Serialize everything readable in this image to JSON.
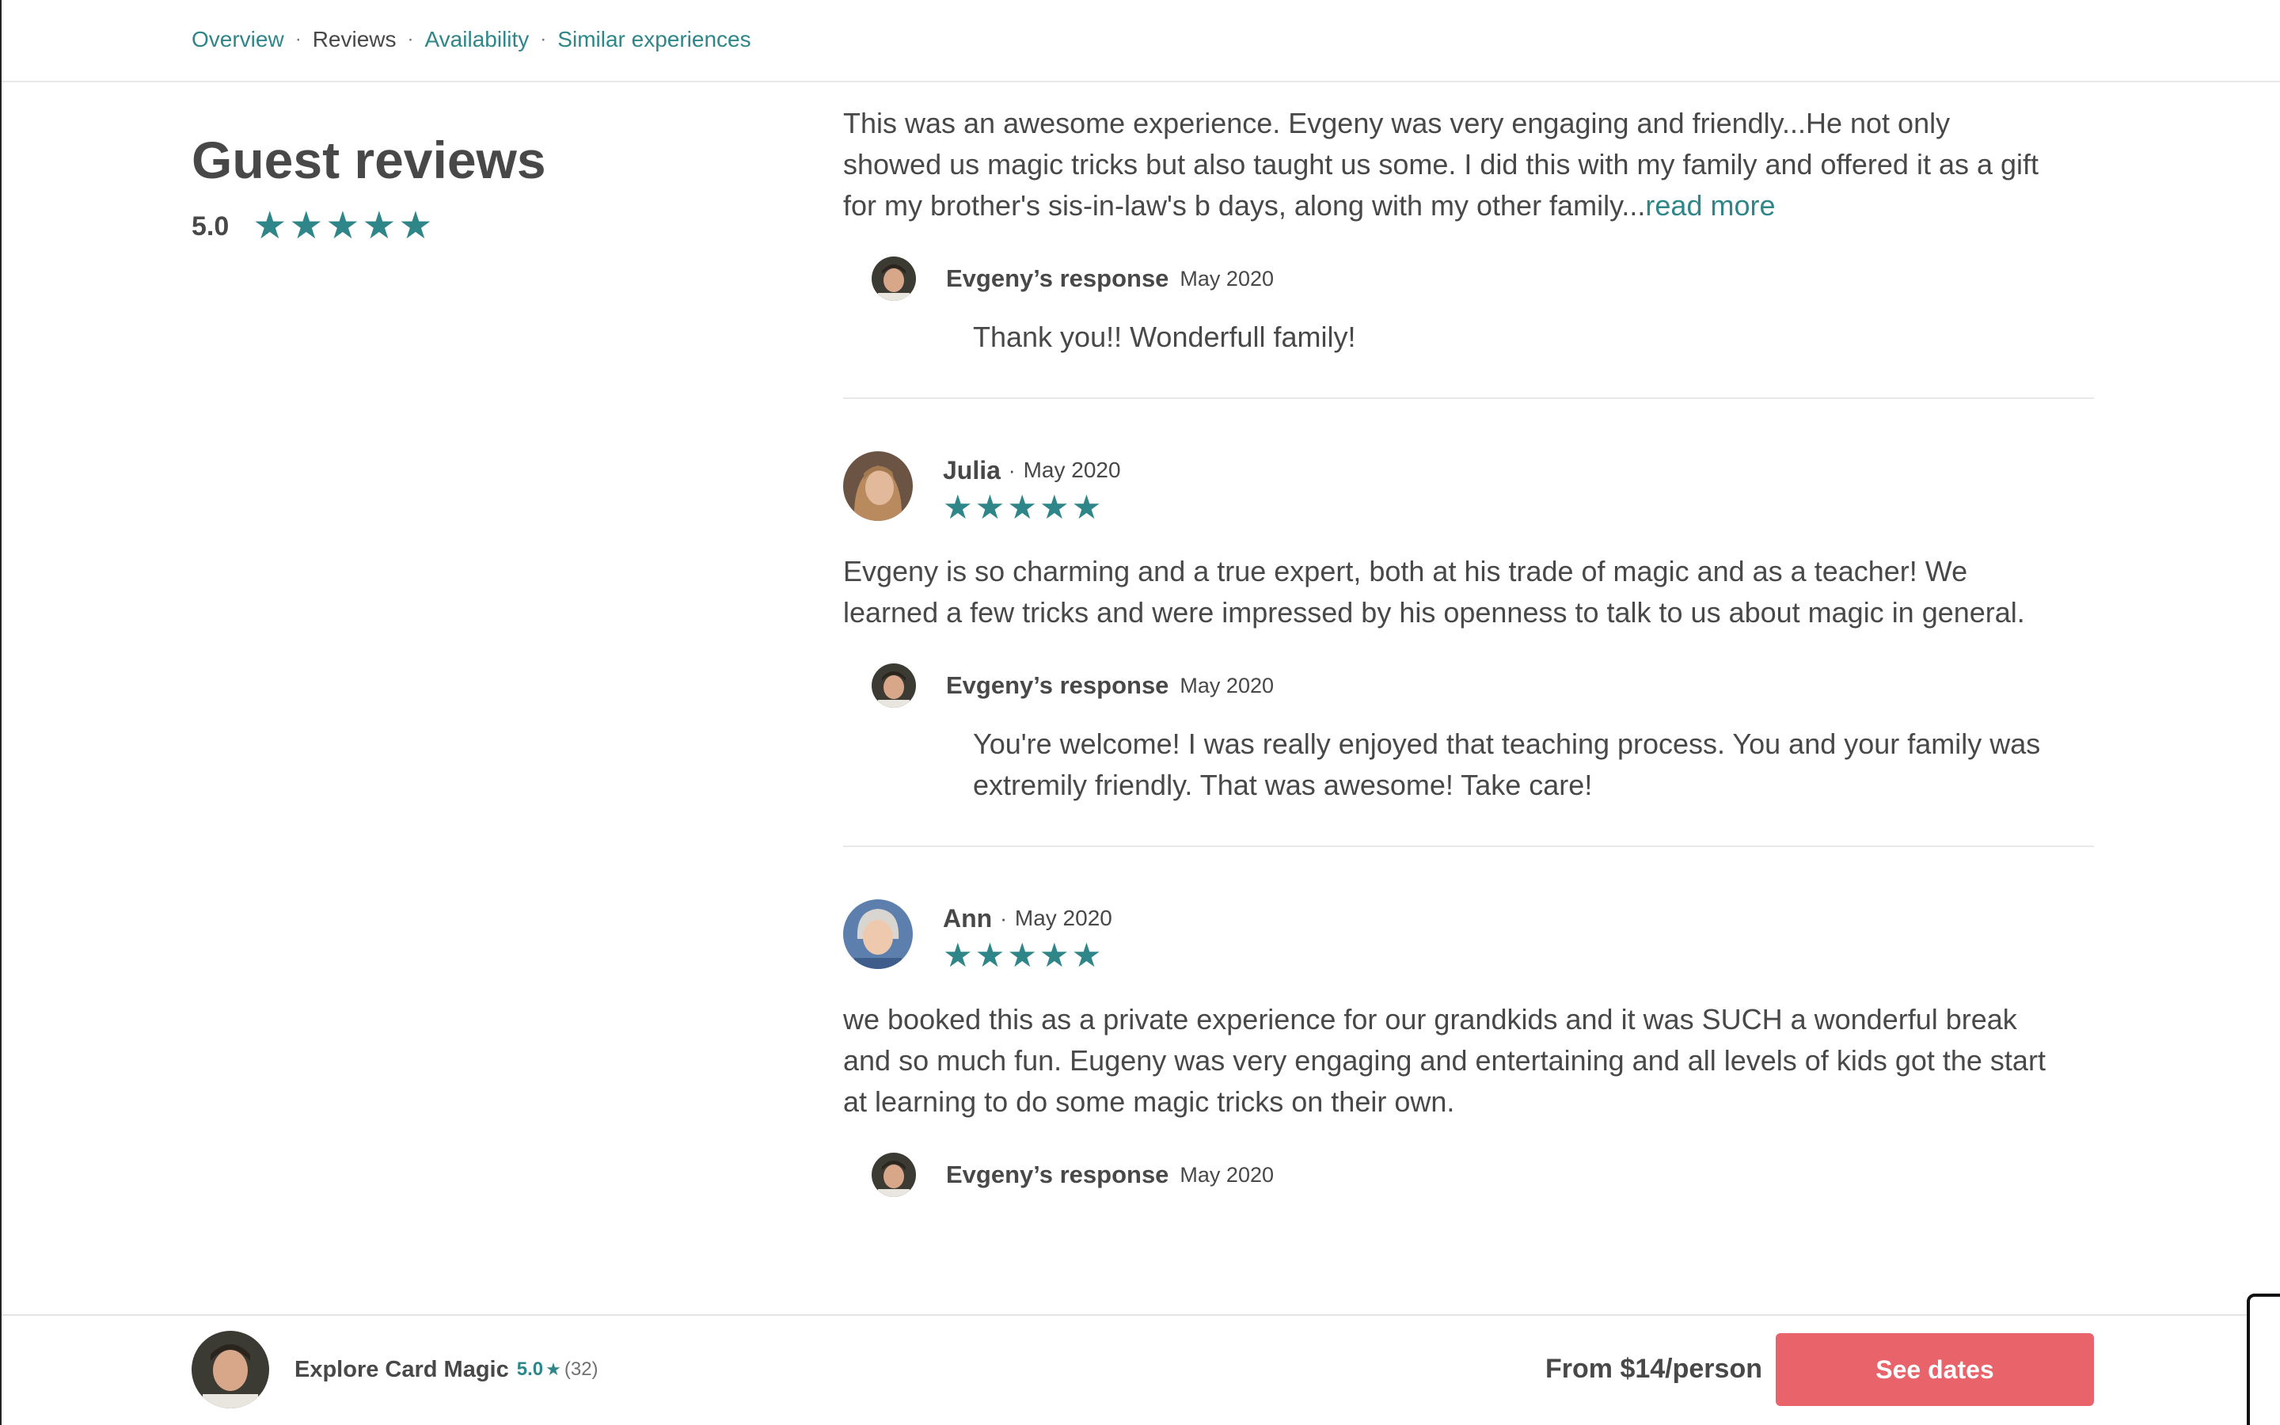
{
  "subnav": {
    "items": [
      {
        "label": "Overview"
      },
      {
        "label": "Reviews"
      },
      {
        "label": "Availability"
      },
      {
        "label": "Similar experiences"
      }
    ],
    "separator": "·"
  },
  "reviews_section": {
    "heading": "Guest reviews",
    "overall_score": "5.0",
    "overall_stars": 5
  },
  "reviews": [
    {
      "text": "This was an awesome experience. Evgeny was very engaging and friendly...He not only showed us magic tricks but also taught us some. I did this with my family and offered it as a gift for my brother's sis-in-law's b days, along with my other family...",
      "read_more": "read more",
      "response": {
        "name": "Evgeny’s response",
        "date": "May 2020",
        "text": "Thank you!! Wonderfull family!"
      }
    },
    {
      "name": "Julia",
      "separator": "·",
      "date": "May 2020",
      "stars": 5,
      "text": "Evgeny is so charming and a true expert, both at his trade of magic and as a teacher! We learned a few tricks and were impressed by his openness to talk to us about magic in general.",
      "response": {
        "name": "Evgeny’s response",
        "date": "May 2020",
        "text": "You're welcome! I was really enjoyed that teaching process. You and your family was extremily friendly. That was awesome! Take care!"
      }
    },
    {
      "name": "Ann",
      "separator": "·",
      "date": "May 2020",
      "stars": 5,
      "text": "we booked this as a private experience for our grandkids and it was SUCH a wonderful break and so much fun. Eugeny was very engaging and entertaining and all levels of kids got the start at learning to do some magic tricks on their own.",
      "response": {
        "name": "Evgeny’s response",
        "date": "May 2020"
      }
    }
  ],
  "booking_bar": {
    "title": "Explore Card Magic",
    "rating": "5.0",
    "rating_icon": "star-icon",
    "review_count": "(32)",
    "price": "From $14/person",
    "cta": "See dates"
  },
  "icons": {
    "star": "★"
  },
  "colors": {
    "accent_teal": "#2f8689",
    "cta_coral": "#e8636a",
    "text": "#484848",
    "divider": "#e8e8e8"
  }
}
